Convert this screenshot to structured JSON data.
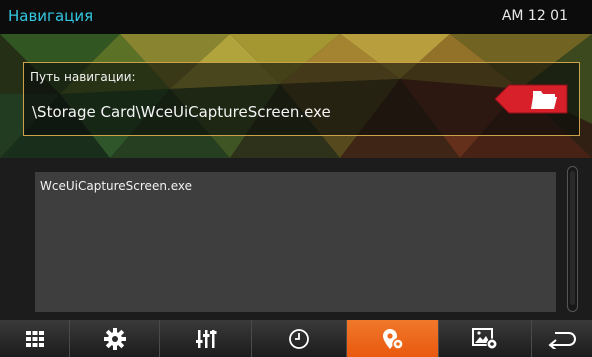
{
  "status_bar": {
    "title": "Навигация",
    "time": "AM 12 01"
  },
  "path_panel": {
    "label": "Путь навигации:",
    "value": "\\Storage Card\\WceUiCaptureScreen.exe",
    "browse_icon": "folder-open-icon"
  },
  "file_list": {
    "items": [
      {
        "name": "WceUiCaptureScreen.exe"
      }
    ]
  },
  "bottom_nav": {
    "items": [
      {
        "icon": "grid-icon",
        "active": false
      },
      {
        "icon": "gear-icon",
        "active": false
      },
      {
        "icon": "equalizer-icon",
        "active": false
      },
      {
        "icon": "clock-icon",
        "active": false
      },
      {
        "icon": "navigation-settings-icon",
        "active": true
      },
      {
        "icon": "picture-settings-icon",
        "active": false
      },
      {
        "icon": "back-arrow-icon",
        "active": false
      }
    ]
  },
  "colors": {
    "title": "#33c8e0",
    "accent_active": "#ee6a1c",
    "panel_border": "#c9a24a",
    "folder_red": "#d7202a"
  }
}
